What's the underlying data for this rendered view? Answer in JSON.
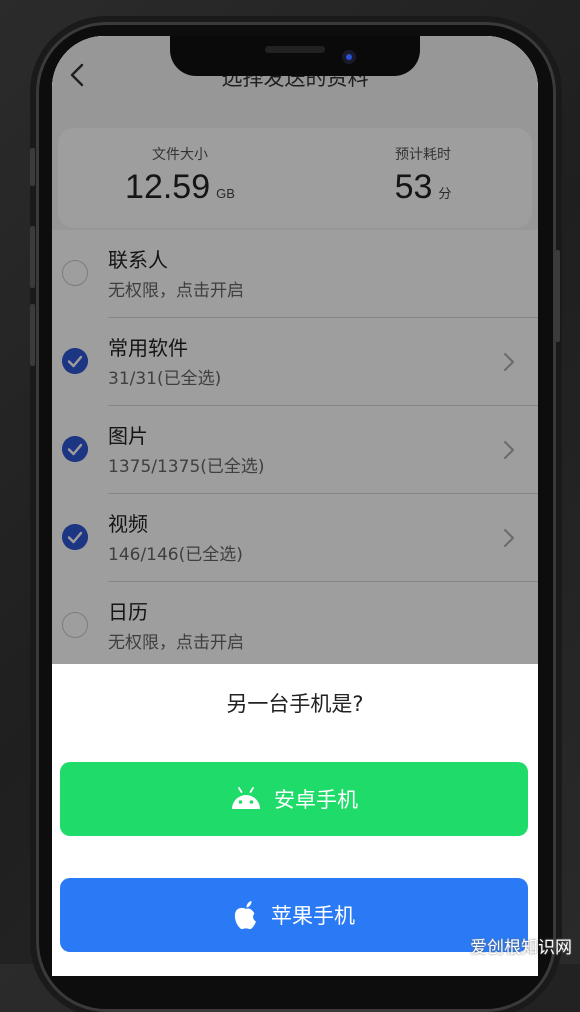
{
  "header": {
    "title": "选择发送的资料"
  },
  "summary": {
    "size_label": "文件大小",
    "size_value": "12.59",
    "size_unit": "GB",
    "time_label": "预计耗时",
    "time_value": "53",
    "time_unit": "分"
  },
  "items": [
    {
      "name": "联系人",
      "sub": "无权限，点击开启",
      "checked": false
    },
    {
      "name": "常用软件",
      "sub": "31/31(已全选)",
      "checked": true
    },
    {
      "name": "图片",
      "sub": "1375/1375(已全选)",
      "checked": true
    },
    {
      "name": "视频",
      "sub": "146/146(已全选)",
      "checked": true
    },
    {
      "name": "日历",
      "sub": "无权限，点击开启",
      "checked": false
    }
  ],
  "sheet": {
    "title": "另一台手机是?",
    "android_label": "安卓手机",
    "apple_label": "苹果手机"
  },
  "watermark": "爱创根知识网",
  "colors": {
    "check": "#2f57d6",
    "android_button": "#1fdb6a",
    "apple_button": "#2a7af5"
  }
}
